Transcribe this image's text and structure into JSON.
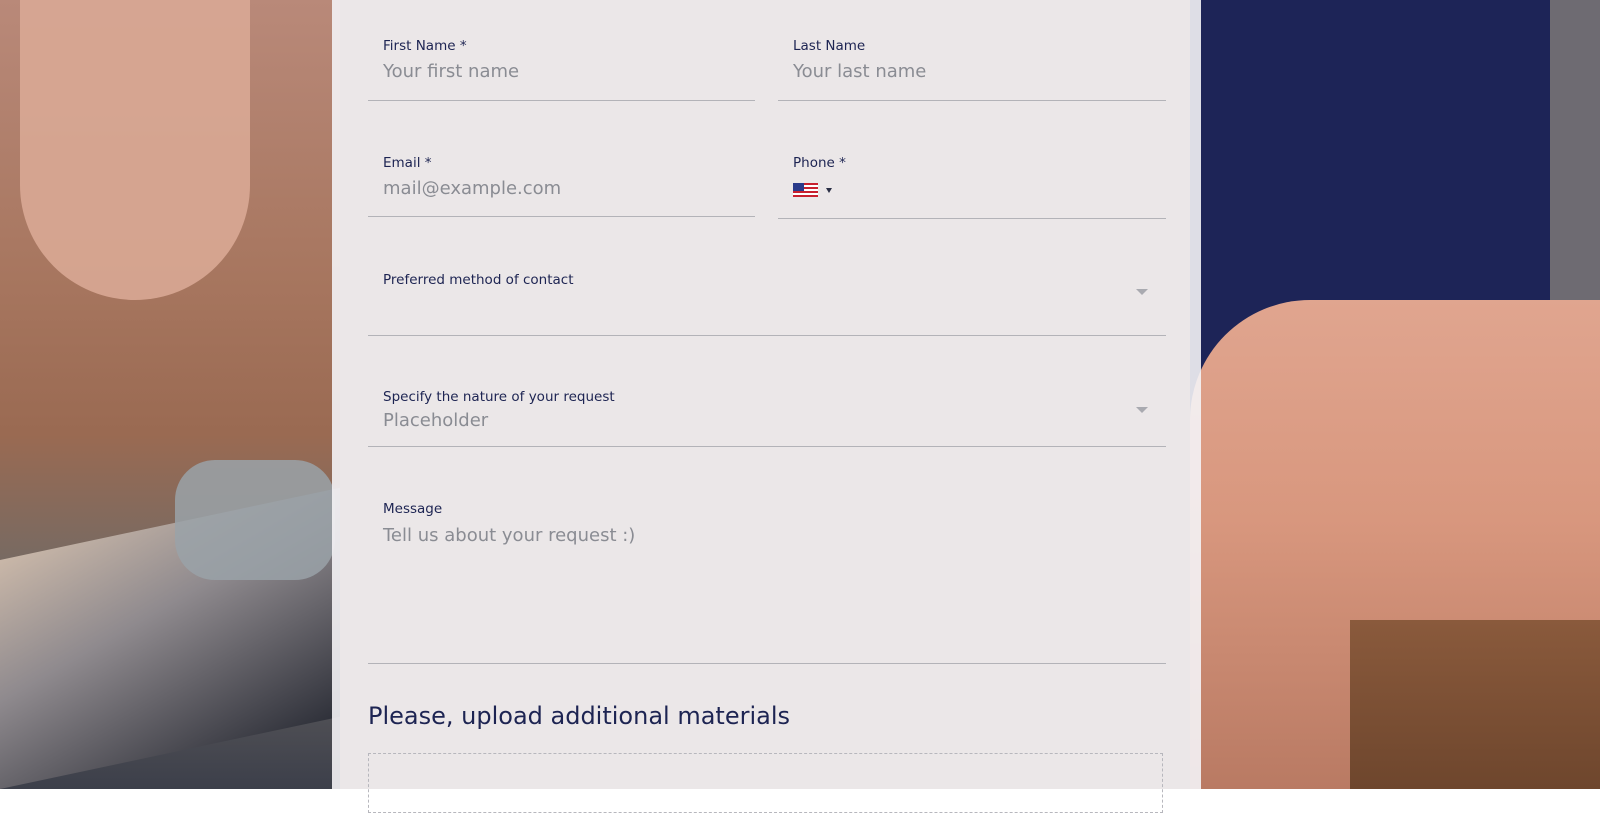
{
  "form": {
    "first_name": {
      "label": "First Name *",
      "placeholder": "Your first name"
    },
    "last_name": {
      "label": "Last Name",
      "placeholder": "Your last name"
    },
    "email": {
      "label": "Email  *",
      "placeholder": "mail@example.com"
    },
    "phone": {
      "label": "Phone *",
      "country_icon": "us-flag-icon",
      "value": ""
    },
    "contact_method": {
      "label": "Preferred method of contact",
      "value": ""
    },
    "request_nature": {
      "label": "Specify the nature of your request",
      "placeholder": "Placeholder"
    },
    "message": {
      "label": "Message",
      "placeholder": "Tell us about your request :)"
    }
  },
  "upload": {
    "title": "Please, upload additional materials"
  },
  "colors": {
    "label_text": "#1d2452",
    "placeholder_text": "#8a8c93",
    "panel_background": "#f4f3f6",
    "field_underline": "#b3b3b8"
  }
}
